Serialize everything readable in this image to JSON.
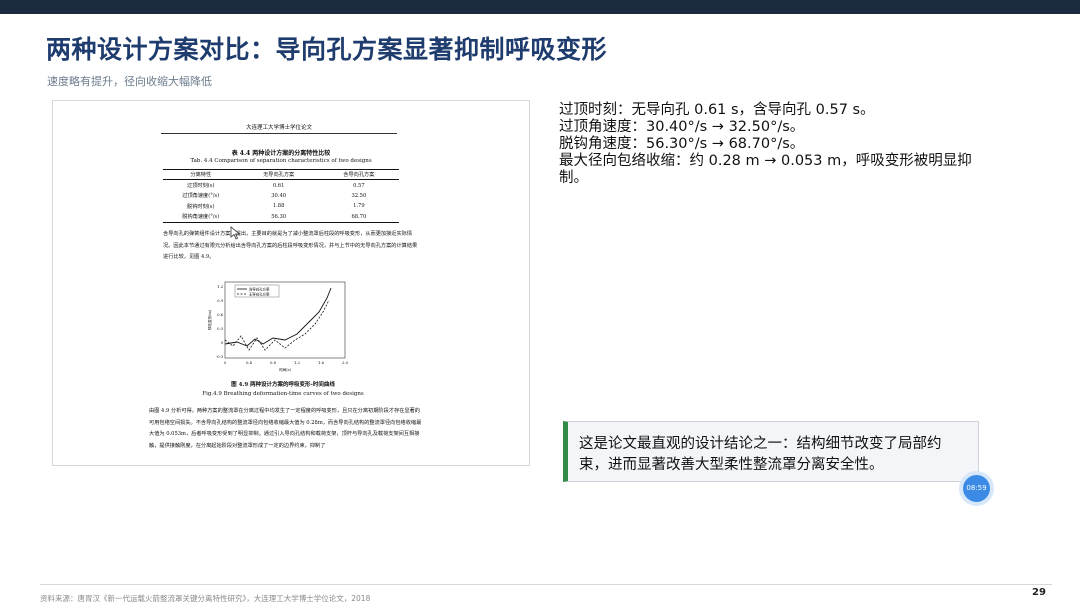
{
  "slide": {
    "title": "两种设计方案对比：导向孔方案显著抑制呼吸变形",
    "subtitle": "速度略有提升，径向收缩大幅降低",
    "page_number": "29",
    "source": "资料来源：唐胃汉《新一代运载火箭整流罩关键分离特性研究》，大连理工大学博士学位论文，2018",
    "timer": "08:59"
  },
  "points": [
    "过顶时刻：无导向孔 0.61 s，含导向孔 0.57 s。",
    "过顶角速度：30.40°/s → 32.50°/s。",
    "脱钩角速度：56.30°/s → 68.70°/s。",
    "最大径向包络收缩：约 0.28 m → 0.053 m，呼吸变形被明显抑制。"
  ],
  "note": "这是论文最直观的设计结论之一：结构细节改变了局部约束，进而显著改善大型柔性整流罩分离安全性。",
  "document": {
    "header": "大连理工大学博士学位论文",
    "table_caption_cn": "表 4.4 两种设计方案的分离特性比较",
    "table_caption_en": "Tab. 4.4 Comparison of separation characteristics of two designs",
    "table": {
      "headers": [
        "分离特性",
        "无导向孔方案",
        "含导向孔方案"
      ],
      "rows": [
        [
          "过顶时刻(s)",
          "0.61",
          "0.57"
        ],
        [
          "过顶角速度(°/s)",
          "30.40",
          "32.50"
        ],
        [
          "脱钩时刻(s)",
          "1.88",
          "1.79"
        ],
        [
          "脱钩角速度(°/s)",
          "56.30",
          "68.70"
        ]
      ]
    },
    "paragraph1": "含导向孔的弹簧组件设计方案的提出，主要目的就是为了减小整流罩后柱段的呼吸变形，从而更加接近实际情况。因此本节通过有限元分析给出含导向孔方案的后柱段呼吸变形情况，并与上节中的无导向孔方案的计算结果进行比较，见图 4.9。",
    "figure_caption_cn": "图 4.9 两种设计方案的呼吸变形-时间曲线",
    "figure_caption_en": "Fig.4.9 Breathing deformation-time curves of two designs",
    "paragraph2": "由图 4.9 分析可得，两种方案的整流罩在分离过程中均发生了一定程度的呼吸变形，且只在分离初期阶段才存在显著的可用包络空间损失。不含导向孔结构的整流罩径向包络收缩最大值为 0.28m，而含导向孔结构的整流罩径向包络收缩最大值为 0.053m，后者呼吸变形受到了明显抑制。通过引入导向孔结构和载荷支架，顶杆与导向孔及载荷支架间互相接触，提供接触刚度，在分离起始阶段对整流罩形成了一定的边界约束，抑制了",
    "graph": {
      "legend": [
        "含导向孔方案",
        "无导向孔方案"
      ],
      "yticks": [
        "1.2",
        "0.9",
        "0.6",
        "0.3",
        "0",
        "-0.3"
      ],
      "xticks": [
        "0",
        "0.4",
        "0.8",
        "1.2",
        "1.6",
        "2.0"
      ],
      "xlabel": "时间(s)",
      "ylabel": "呼吸变形(m)"
    }
  }
}
